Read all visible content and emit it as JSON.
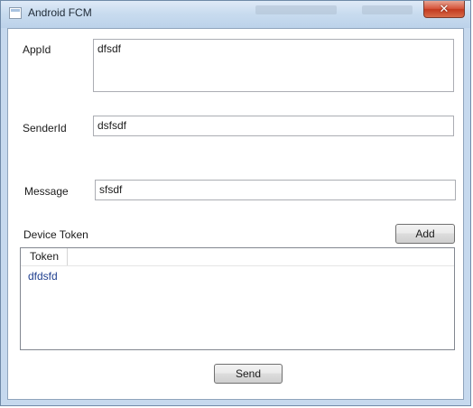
{
  "window": {
    "title": "Android FCM",
    "close_glyph": "✕"
  },
  "form": {
    "appid_label": "AppId",
    "appid_value": "dfsdf",
    "senderid_label": "SenderId",
    "senderid_value": "dsfsdf",
    "message_label": "Message",
    "message_value": "sfsdf",
    "device_token_label": "Device Token",
    "add_label": "Add",
    "send_label": "Send"
  },
  "token_list": {
    "columns": [
      "Token"
    ],
    "rows": [
      "dfdsfd"
    ]
  }
}
